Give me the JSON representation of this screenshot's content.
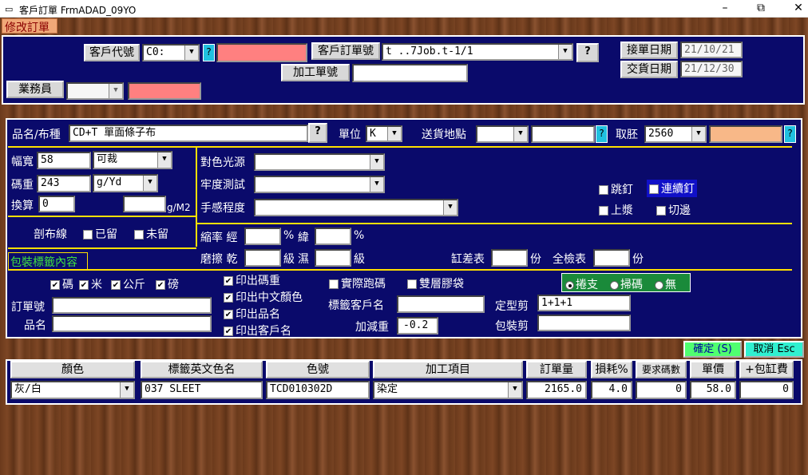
{
  "window": {
    "title": "客戶訂單  FrmADAD_09YO",
    "icon": "window-icon"
  },
  "mode": "修改訂單",
  "top": {
    "customer_code_label": "客戶代號",
    "customer_code": "C0:",
    "customer_name": "",
    "customer_order_label": "客戶訂單號",
    "customer_order": "t ..7Job.t-1/1",
    "process_order_label": "加工單號",
    "process_order": "",
    "salesman_label": "業務員",
    "salesman": "",
    "salesman_name": "",
    "order_date_label": "接單日期",
    "order_date": "21/10/21",
    "delivery_date_label": "交貨日期",
    "delivery_date": "21/12/30",
    "q": "?"
  },
  "mid": {
    "product_label": "品名/布種",
    "product": "CD+T 單面條子布",
    "unit_label": "單位",
    "unit": "K",
    "ship_label": "送貨地點",
    "ship": "",
    "ship2": "",
    "grey_label": "取胚",
    "grey_code": "2560",
    "grey_name": "",
    "width_label": "幅寬",
    "width": "58",
    "cut": "可裁",
    "weight_label": "碼重",
    "weight": "243",
    "weight_unit": "g/Yd",
    "convert_label": "換算",
    "convert": "0",
    "gm2": "",
    "gm2_unit": "g/M2",
    "light_label": "對色光源",
    "fast_label": "牢度測試",
    "hand_label": "手感程度",
    "skip": "跳釘",
    "cont": "連續釘",
    "starch": "上漿",
    "cutedge": "切邊",
    "selvage_label": "剖布線",
    "keep": "已留",
    "nokeep": "未留",
    "shrink_label": "縮率 經",
    "shrink_pct": "%",
    "weft": "緯",
    "weft_pct": "%",
    "rub_label": "磨擦 乾",
    "rub_level": "級",
    "wet": "濕",
    "wet_level": "級",
    "vat_label": "缸差表",
    "copies": "份",
    "full_label": "全檢表",
    "copies2": "份",
    "pack_title": "包裝標籤內容",
    "u_yard": "碼",
    "u_m": "米",
    "u_kg": "公斤",
    "u_lb": "磅",
    "print_weight": "印出碼重",
    "print_color": "印出中文顏色",
    "print_product": "印出品名",
    "print_customer": "印出客戶名",
    "actual": "實際跑碼",
    "double": "雙層膠袋",
    "roll": "捲支",
    "sweep": "掃碼",
    "none": "無",
    "order_no_label": "訂單號",
    "product_name_label": "品名",
    "tag_cust_label": "標籤客戶名",
    "adjust_label": "加減重",
    "adjust": "-0.2",
    "shape_label": "定型剪",
    "shape": "1+1+1",
    "pack_label": "包裝剪",
    "pack": "",
    "ok": "確定 (S)",
    "cancel": "取消 Esc"
  },
  "grid": {
    "headers": [
      "顏色",
      "標籤英文色名",
      "色號",
      "加工項目",
      "訂單量",
      "損耗%",
      "要求碼數",
      "單價",
      "+包缸費"
    ],
    "row": [
      "灰/白",
      "037 SLEET",
      "TCD010302D",
      "染定",
      "2165.0",
      "4.0",
      "0",
      "58.0",
      "0"
    ]
  }
}
